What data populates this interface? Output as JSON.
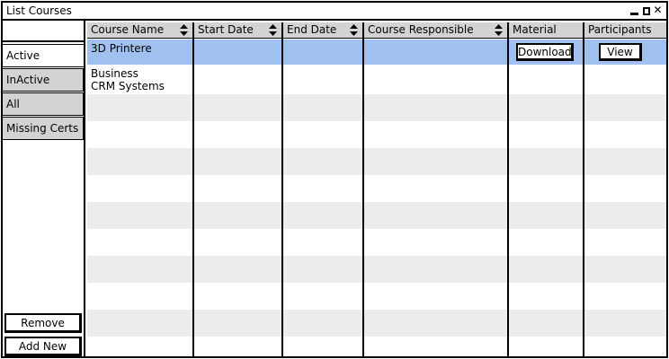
{
  "window": {
    "title": "List Courses",
    "controls": [
      "minimize-icon",
      "maximize-icon",
      "close-icon"
    ],
    "close_glyph": "✕"
  },
  "sidebar": {
    "filters": [
      {
        "label": "Active",
        "active": true
      },
      {
        "label": "InActive",
        "active": false
      },
      {
        "label": "All",
        "active": false
      },
      {
        "label": "Missing Certs",
        "active": false
      }
    ],
    "remove_label": "Remove",
    "add_new_label": "Add New"
  },
  "table": {
    "columns": [
      {
        "label": "Course Name",
        "sortable": true
      },
      {
        "label": "Start Date",
        "sortable": true
      },
      {
        "label": "End Date",
        "sortable": true
      },
      {
        "label": "Course Responsible",
        "sortable": true
      },
      {
        "label": "Material",
        "sortable": false
      },
      {
        "label": "Participants",
        "sortable": false
      }
    ],
    "rows": [
      {
        "course_name": "3D Printere",
        "start_date": "",
        "end_date": "",
        "responsible": "",
        "material_button": "Download",
        "participants_button": "View",
        "selected": true
      },
      {
        "course_name": "Business\nCRM Systems",
        "start_date": "",
        "end_date": "",
        "responsible": "",
        "material_button": "",
        "participants_button": "",
        "selected": false
      }
    ]
  },
  "colors": {
    "selected_row": "#a0c0f0",
    "header_bg": "#d3d3d3",
    "alt_row": "#ececec",
    "inactive_tab": "#d3d3d3"
  }
}
